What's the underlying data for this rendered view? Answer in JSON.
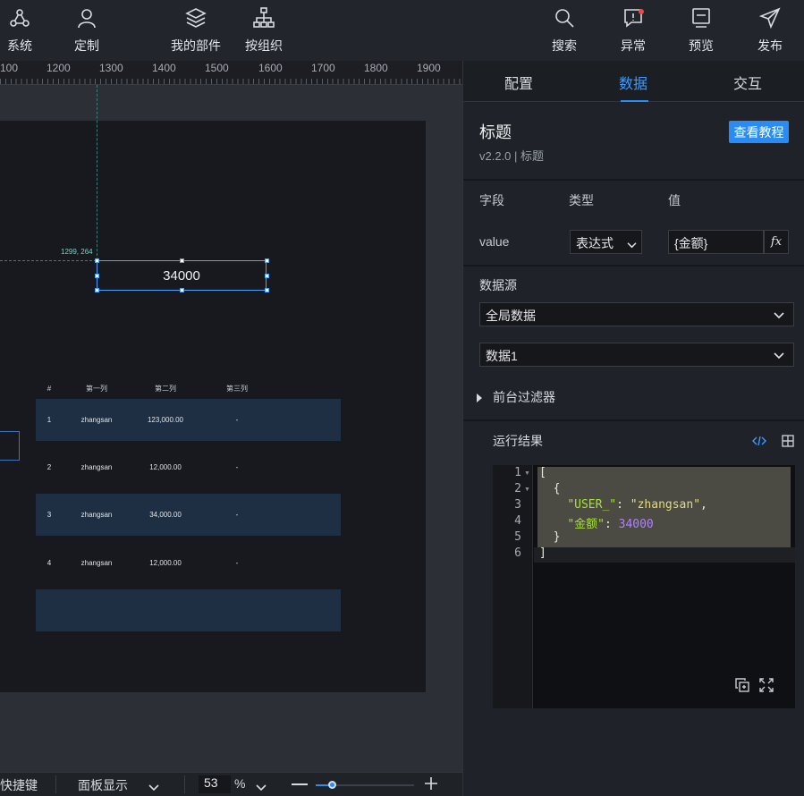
{
  "topbar": {
    "left_items": [
      {
        "label": "系统",
        "icon": "system-icon"
      },
      {
        "label": "定制",
        "icon": "user-icon"
      },
      {
        "label": "我的部件",
        "icon": "layers-icon"
      },
      {
        "label": "按组织",
        "icon": "org-tree-icon"
      }
    ],
    "right_items": [
      {
        "label": "搜索",
        "icon": "search-icon"
      },
      {
        "label": "异常",
        "icon": "alert-icon"
      },
      {
        "label": "预览",
        "icon": "preview-icon"
      },
      {
        "label": "发布",
        "icon": "send-icon"
      }
    ],
    "alert_dot_color": "#e84a4a"
  },
  "ruler": {
    "labels": [
      "100",
      "1200",
      "1300",
      "1400",
      "1500",
      "1600",
      "1700",
      "1800",
      "1900"
    ]
  },
  "canvas": {
    "coordinate_readout": "1299, 264",
    "title_value": "34000",
    "table": {
      "headers": [
        "#",
        "第一列",
        "第二列",
        "第三列"
      ],
      "rows": [
        [
          "1",
          "zhangsan",
          "123,000.00",
          "-"
        ],
        [
          "2",
          "zhangsan",
          "12,000.00",
          "-"
        ],
        [
          "3",
          "zhangsan",
          "34,000.00",
          "-"
        ],
        [
          "4",
          "zhangsan",
          "12,000.00",
          "-"
        ]
      ]
    }
  },
  "bottombar": {
    "shortcuts_label": "快捷键",
    "panel_display_label": "面板显示",
    "zoom_value": "53",
    "zoom_unit": "%",
    "zoom_fraction": 0.16
  },
  "panel": {
    "tabs": [
      "配置",
      "数据",
      "交互"
    ],
    "active_tab": "数据",
    "component_title": "标题",
    "component_version": "v2.2.0 | 标题",
    "tutorial_button": "查看教程",
    "field_headers": {
      "field": "字段",
      "type": "类型",
      "value": "值"
    },
    "field_row": {
      "name": "value",
      "type": "表达式",
      "expression": "{金额}",
      "fx_label": "fx"
    },
    "datasource_label": "数据源",
    "datasource_select": "全局数据",
    "dataset_select": "数据1",
    "filter_label": "前台过滤器",
    "result_label": "运行结果",
    "accent_color": "#2e8cf0",
    "code_lines": [
      "1",
      "2",
      "3",
      "4",
      "5",
      "6"
    ],
    "code": {
      "open_bracket": "[",
      "open_brace": "{",
      "key1": "\"USER_\"",
      "val1": "\"zhangsan\"",
      "key2": "\"金额\"",
      "val2": "34000",
      "close_brace": "}",
      "close_bracket": "]"
    }
  }
}
